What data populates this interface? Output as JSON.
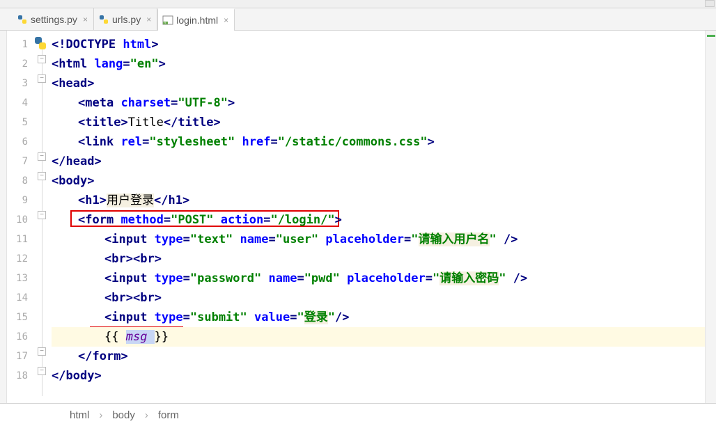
{
  "tabs": [
    {
      "label": "settings.py",
      "type": "py"
    },
    {
      "label": "urls.py",
      "type": "py"
    },
    {
      "label": "login.html",
      "type": "html",
      "active": true
    }
  ],
  "lines": {
    "l1": {
      "num": "1",
      "parts": [
        [
          "punct",
          "<!"
        ],
        [
          "doctype",
          "DOCTYPE"
        ],
        [
          "punct",
          " "
        ],
        [
          "attr",
          "html"
        ],
        [
          "punct",
          ">"
        ]
      ]
    },
    "l2": {
      "num": "2",
      "indent": 0,
      "parts": [
        [
          "punct",
          "<"
        ],
        [
          "tag",
          "html "
        ],
        [
          "attr",
          "lang"
        ],
        [
          "punct",
          "="
        ],
        [
          "val",
          "\"en\""
        ],
        [
          "punct",
          ">"
        ]
      ]
    },
    "l3": {
      "num": "3",
      "indent": 0,
      "parts": [
        [
          "punct",
          "<"
        ],
        [
          "tag",
          "head"
        ],
        [
          "punct",
          ">"
        ]
      ]
    },
    "l4": {
      "num": "4",
      "indent": 1,
      "parts": [
        [
          "punct",
          "<"
        ],
        [
          "tag",
          "meta "
        ],
        [
          "attr",
          "charset"
        ],
        [
          "punct",
          "="
        ],
        [
          "val",
          "\"UTF-8\""
        ],
        [
          "punct",
          ">"
        ]
      ]
    },
    "l5": {
      "num": "5",
      "indent": 1,
      "parts": [
        [
          "punct",
          "<"
        ],
        [
          "tag",
          "title"
        ],
        [
          "punct",
          ">"
        ],
        [
          "text",
          "Title"
        ],
        [
          "punct",
          "</"
        ],
        [
          "tag",
          "title"
        ],
        [
          "punct",
          ">"
        ]
      ]
    },
    "l6": {
      "num": "6",
      "indent": 1,
      "parts": [
        [
          "punct",
          "<"
        ],
        [
          "tag",
          "link "
        ],
        [
          "attr",
          "rel"
        ],
        [
          "punct",
          "="
        ],
        [
          "val",
          "\"stylesheet\""
        ],
        [
          "tag",
          " "
        ],
        [
          "attr",
          "href"
        ],
        [
          "punct",
          "="
        ],
        [
          "val",
          "\"/static/commons.css\""
        ],
        [
          "punct",
          ">"
        ]
      ]
    },
    "l7": {
      "num": "7",
      "indent": 0,
      "parts": [
        [
          "punct",
          "</"
        ],
        [
          "tag",
          "head"
        ],
        [
          "punct",
          ">"
        ]
      ]
    },
    "l8": {
      "num": "8",
      "indent": 0,
      "parts": [
        [
          "punct",
          "<"
        ],
        [
          "tag",
          "body"
        ],
        [
          "punct",
          ">"
        ]
      ]
    },
    "l9": {
      "num": "9",
      "indent": 1,
      "parts": [
        [
          "punct",
          "<"
        ],
        [
          "tag",
          "h1"
        ],
        [
          "punct",
          ">"
        ],
        [
          "cjk",
          "用户登录"
        ],
        [
          "punct",
          "</"
        ],
        [
          "tag",
          "h1"
        ],
        [
          "punct",
          ">"
        ]
      ]
    },
    "l10": {
      "num": "10",
      "indent": 1,
      "parts": [
        [
          "punct",
          "<"
        ],
        [
          "tag",
          "form "
        ],
        [
          "attr",
          "method"
        ],
        [
          "punct",
          "="
        ],
        [
          "val",
          "\"POST\""
        ],
        [
          "tag",
          " "
        ],
        [
          "attr",
          "action"
        ],
        [
          "punct",
          "="
        ],
        [
          "val",
          "\"/login/\""
        ],
        [
          "punct",
          ">"
        ]
      ]
    },
    "l11": {
      "num": "11",
      "indent": 2,
      "parts": [
        [
          "punct",
          "<"
        ],
        [
          "tag",
          "input "
        ],
        [
          "attr",
          "type"
        ],
        [
          "punct",
          "="
        ],
        [
          "val",
          "\"text\""
        ],
        [
          "tag",
          " "
        ],
        [
          "attr",
          "name"
        ],
        [
          "punct",
          "="
        ],
        [
          "val",
          "\"user\""
        ],
        [
          "tag",
          " "
        ],
        [
          "attr",
          "placeholder"
        ],
        [
          "punct",
          "="
        ],
        [
          "val",
          "\""
        ],
        [
          "cjkval",
          "请输入用户名"
        ],
        [
          "val",
          "\""
        ],
        [
          "punct",
          " />"
        ]
      ]
    },
    "l12": {
      "num": "12",
      "indent": 2,
      "parts": [
        [
          "punct",
          "<"
        ],
        [
          "tag",
          "br"
        ],
        [
          "punct",
          "><"
        ],
        [
          "tag",
          "br"
        ],
        [
          "punct",
          ">"
        ]
      ]
    },
    "l13": {
      "num": "13",
      "indent": 2,
      "parts": [
        [
          "punct",
          "<"
        ],
        [
          "tag",
          "input "
        ],
        [
          "attr",
          "type"
        ],
        [
          "punct",
          "="
        ],
        [
          "val",
          "\"password\""
        ],
        [
          "tag",
          " "
        ],
        [
          "attr",
          "name"
        ],
        [
          "punct",
          "="
        ],
        [
          "val",
          "\"pwd\""
        ],
        [
          "tag",
          " "
        ],
        [
          "attr",
          "placeholder"
        ],
        [
          "punct",
          "="
        ],
        [
          "val",
          "\""
        ],
        [
          "cjkval",
          "请输入密码"
        ],
        [
          "val",
          "\""
        ],
        [
          "punct",
          " />"
        ]
      ]
    },
    "l14": {
      "num": "14",
      "indent": 2,
      "parts": [
        [
          "punct",
          "<"
        ],
        [
          "tag",
          "br"
        ],
        [
          "punct",
          "><"
        ],
        [
          "tag",
          "br"
        ],
        [
          "punct",
          ">"
        ]
      ]
    },
    "l15": {
      "num": "15",
      "indent": 2,
      "parts": [
        [
          "punct",
          "<"
        ],
        [
          "tag",
          "input "
        ],
        [
          "attr",
          "type"
        ],
        [
          "punct",
          "="
        ],
        [
          "val",
          "\"submit\""
        ],
        [
          "tag",
          " "
        ],
        [
          "attr",
          "value"
        ],
        [
          "punct",
          "="
        ],
        [
          "val",
          "\""
        ],
        [
          "cjkval",
          "登录"
        ],
        [
          "val",
          "\""
        ],
        [
          "punct",
          "/>"
        ]
      ]
    },
    "l16": {
      "num": "16",
      "indent": 2,
      "current": true,
      "parts": [
        [
          "text",
          "{{ "
        ],
        [
          "tvar",
          "msg "
        ],
        [
          "text",
          "}}"
        ]
      ]
    },
    "l17": {
      "num": "17",
      "indent": 1,
      "parts": [
        [
          "punct",
          "</"
        ],
        [
          "tag",
          "form"
        ],
        [
          "punct",
          ">"
        ]
      ]
    },
    "l18": {
      "num": "18",
      "indent": 0,
      "parts": [
        [
          "punct",
          "</"
        ],
        [
          "tag",
          "body"
        ],
        [
          "punct",
          ">"
        ]
      ]
    }
  },
  "breadcrumb": [
    "html",
    "body",
    "form"
  ]
}
